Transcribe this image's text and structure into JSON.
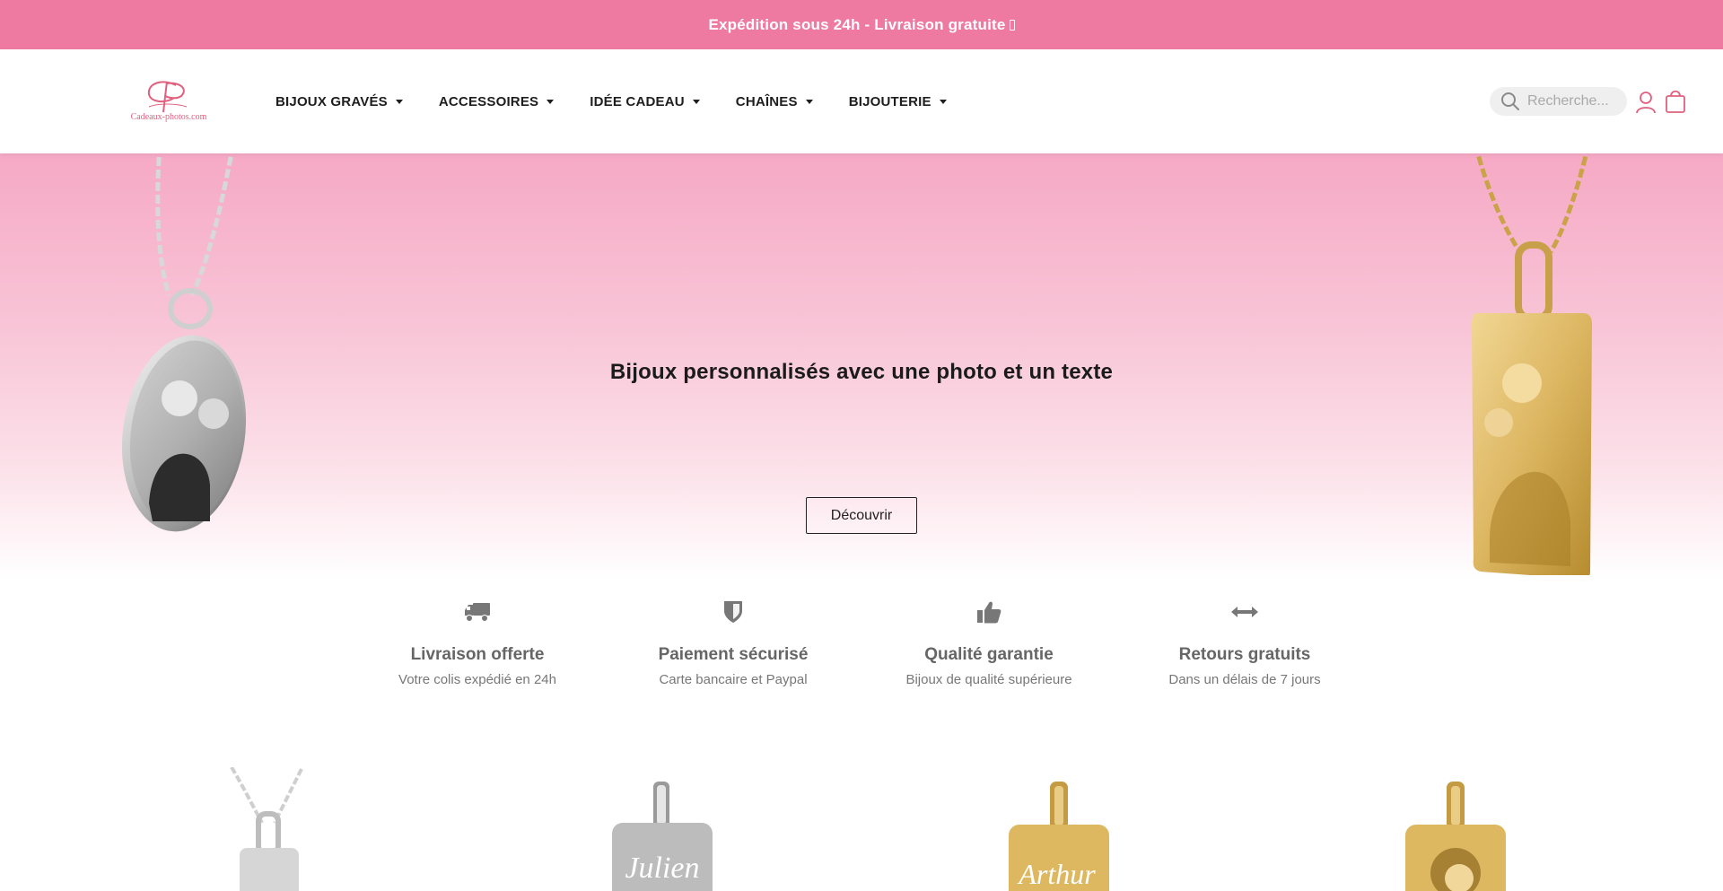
{
  "topbar": {
    "text": "Expédition sous 24h - Livraison gratuite"
  },
  "header": {
    "logo_text": "Cadeaux-photos.com",
    "nav": [
      {
        "label": "BIJOUX GRAVÉS"
      },
      {
        "label": "ACCESSOIRES"
      },
      {
        "label": "IDÉE CADEAU"
      },
      {
        "label": "CHAÎNES"
      },
      {
        "label": "BIJOUTERIE"
      }
    ],
    "search_placeholder": "Recherche..."
  },
  "hero": {
    "title": "Bijoux personnalisés avec une photo et un texte",
    "button": "Découvrir"
  },
  "features": [
    {
      "icon": "truck-icon",
      "title": "Livraison offerte",
      "subtitle": "Votre colis expédié en 24h"
    },
    {
      "icon": "shield-icon",
      "title": "Paiement sécurisé",
      "subtitle": "Carte bancaire et Paypal"
    },
    {
      "icon": "thumbs-up-icon",
      "title": "Qualité garantie",
      "subtitle": "Bijoux de qualité supérieure"
    },
    {
      "icon": "arrows-horizontal-icon",
      "title": "Retours gratuits",
      "subtitle": "Dans un délais de 7 jours"
    }
  ],
  "products": [
    {
      "engraving": ""
    },
    {
      "engraving": "Julien"
    },
    {
      "engraving": "Arthur"
    },
    {
      "engraving": ""
    }
  ],
  "colors": {
    "accent_pink": "#ee7aa1",
    "hero_pink": "#f6a9c5",
    "gold": "#dcb560",
    "silver": "#c8c8c8"
  }
}
